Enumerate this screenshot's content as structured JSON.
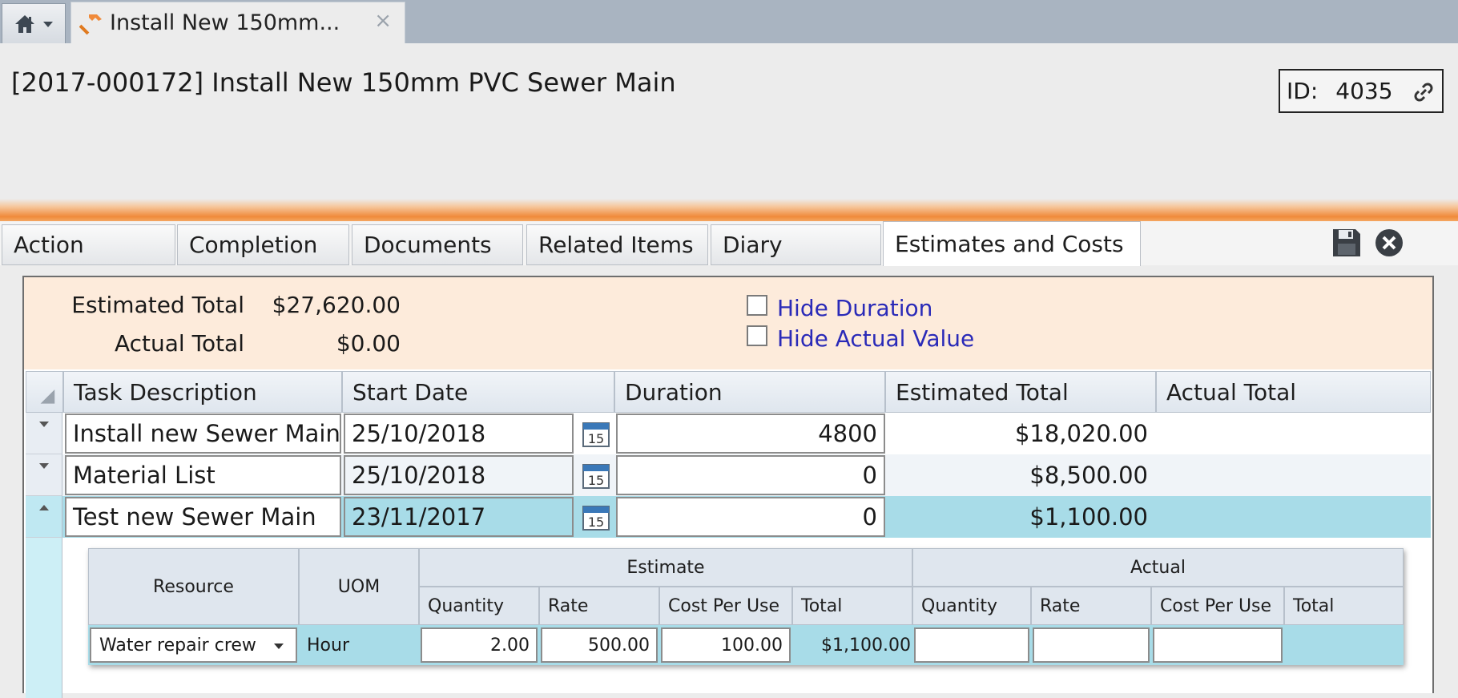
{
  "window": {
    "doc_tab_title": "Install New 150mm...",
    "close_glyph": "×"
  },
  "header": {
    "title": "[2017-000172] Install New 150mm PVC Sewer Main",
    "id_label": "ID:",
    "id_value": "4035"
  },
  "tabs": [
    {
      "label": "Action"
    },
    {
      "label": "Completion"
    },
    {
      "label": "Documents"
    },
    {
      "label": "Related Items"
    },
    {
      "label": "Diary"
    },
    {
      "label": "Estimates and Costs",
      "active": true
    }
  ],
  "summary": {
    "estimated_total_label": "Estimated Total",
    "estimated_total_value": "$27,620.00",
    "actual_total_label": "Actual Total",
    "actual_total_value": "$0.00",
    "hide_duration_label": "Hide Duration",
    "hide_duration_checked": false,
    "hide_actual_label": "Hide Actual Value",
    "hide_actual_checked": false
  },
  "grid": {
    "columns": [
      "Task Description",
      "Start Date",
      "Duration",
      "Estimated Total",
      "Actual Total"
    ],
    "rows": [
      {
        "task": "Install new Sewer Main",
        "start_date": "25/10/2018",
        "duration": "4800",
        "estimated_total": "$18,020.00",
        "actual_total": ""
      },
      {
        "task": "Material List",
        "start_date": "25/10/2018",
        "duration": "0",
        "estimated_total": "$8,500.00",
        "actual_total": ""
      },
      {
        "task": "Test new Sewer Main",
        "start_date": "23/11/2017",
        "duration": "0",
        "estimated_total": "$1,100.00",
        "actual_total": "",
        "selected": true,
        "expanded": true
      }
    ],
    "calendar_day": "15"
  },
  "resources": {
    "col_resource": "Resource",
    "col_uom": "UOM",
    "group_estimate": "Estimate",
    "group_actual": "Actual",
    "sub_cols": [
      "Quantity",
      "Rate",
      "Cost Per Use",
      "Total"
    ],
    "row": {
      "resource": "Water repair crew",
      "uom": "Hour",
      "est_quantity": "2.00",
      "est_rate": "500.00",
      "est_cost_per_use": "100.00",
      "est_total": "$1,100.00",
      "act_quantity": "",
      "act_rate": "",
      "act_cost_per_use": "",
      "act_total": ""
    }
  },
  "colors": {
    "accent_orange": "#f08a3a",
    "selected_row": "#a8dce8",
    "summary_bg": "#fdebdb",
    "link_blue": "#2a2ab8"
  }
}
